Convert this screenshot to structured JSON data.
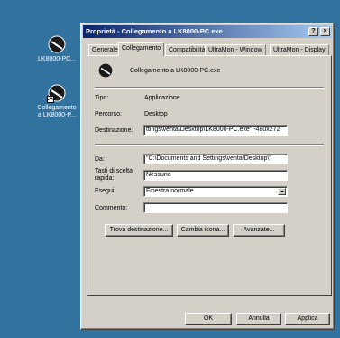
{
  "desktop": {
    "icons": [
      {
        "label": "LK8000-PC..."
      },
      {
        "label": "Collegamento\na LK8000-P..."
      }
    ]
  },
  "window": {
    "title": "Proprietà - Collegamento a LK8000-PC.exe",
    "help_label": "?",
    "close_label": "×"
  },
  "tabs": [
    {
      "label": "Generale"
    },
    {
      "label": "Collegamento"
    },
    {
      "label": "Compatibilità"
    },
    {
      "label": "UltraMon - Window"
    },
    {
      "label": "UltraMon - Display"
    }
  ],
  "shortcut": {
    "name": "Collegamento a LK8000-PC.exe",
    "type_label": "Tipo:",
    "type_value": "Applicazione",
    "path_label": "Percorso:",
    "path_value": "Desktop",
    "target_label": "Destinazione:",
    "target_value": "ttings\\venta\\Desktop\\LK8000-PC.exe\" -480x272",
    "start_label": "Da:",
    "start_value": "\"C:\\Documents and Settings\\venta\\Desktop\\\"",
    "hotkey_label": "Tasti di scelta rapida:",
    "hotkey_value": "Nessuno",
    "run_label": "Esegui:",
    "run_value": "Finestra normale",
    "comment_label": "Commento:",
    "comment_value": ""
  },
  "buttons": {
    "find_target": "Trova destinazione...",
    "change_icon": "Cambia icona...",
    "advanced": "Avanzate...",
    "ok": "OK",
    "cancel": "Annulla",
    "apply": "Applica"
  }
}
